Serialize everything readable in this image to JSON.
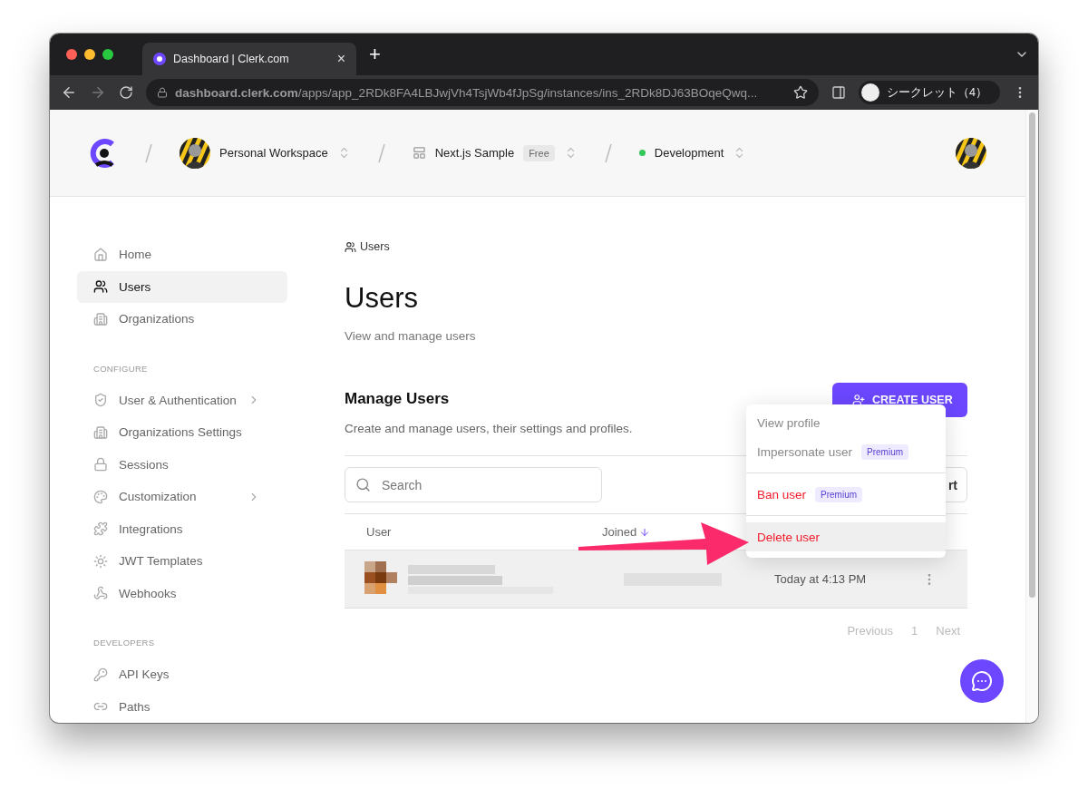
{
  "browser": {
    "tab": {
      "title": "Dashboard | Clerk.com",
      "close": "×"
    },
    "new_tab": "+",
    "url": "**dashboard.clerk.com**/apps/app_2RDk8FA4LBJwjVh4TsjWb4fJpSg/instances/ins_2RDk8DJ63BOqeQwq...",
    "profile": "シークレット（4）"
  },
  "header": {
    "workspace": "Personal Workspace",
    "application": {
      "name": "Next.js Sample",
      "badge": "Free"
    },
    "environment": {
      "name": "Development",
      "color": "#33c759"
    }
  },
  "sidebar": {
    "sections": [
      {
        "items": [
          {
            "label": "Home",
            "selected": false,
            "expandable": false
          },
          {
            "label": "Users",
            "selected": true,
            "expandable": false
          },
          {
            "label": "Organizations",
            "selected": false,
            "expandable": false
          }
        ]
      },
      {
        "title": "CONFIGURE",
        "items": [
          {
            "label": "User & Authentication",
            "selected": false,
            "expandable": true
          },
          {
            "label": "Organizations Settings",
            "selected": false,
            "expandable": false
          },
          {
            "label": "Sessions",
            "selected": false,
            "expandable": false
          },
          {
            "label": "Customization",
            "selected": false,
            "expandable": true
          },
          {
            "label": "Integrations",
            "selected": false,
            "expandable": false
          },
          {
            "label": "JWT Templates",
            "selected": false,
            "expandable": false
          },
          {
            "label": "Webhooks",
            "selected": false,
            "expandable": false
          }
        ]
      },
      {
        "title": "DEVELOPERS",
        "items": [
          {
            "label": "API Keys",
            "selected": false,
            "expandable": false
          },
          {
            "label": "Paths",
            "selected": false,
            "expandable": false
          }
        ]
      }
    ]
  },
  "page": {
    "breadcrumb": "Users",
    "title": "Users",
    "subtitle": "View and manage users"
  },
  "manage": {
    "title": "Manage Users",
    "description": "Create and manage users, their settings and profiles.",
    "create_button": "CREATE USER",
    "export_button": "rt"
  },
  "search": {
    "placeholder": "Search"
  },
  "table": {
    "columns": [
      {
        "label": "User",
        "sorted": false
      },
      {
        "label": "Joined",
        "sorted": true
      }
    ],
    "rows": [
      {
        "last_active": "Today at 4:13 PM",
        "hovered": true
      }
    ]
  },
  "menu": {
    "items": [
      {
        "label": "View profile",
        "kind": "normal",
        "highlighted": false,
        "divider_before": false
      },
      {
        "label": "Impersonate user",
        "kind": "normal",
        "badge": "Premium",
        "highlighted": false,
        "divider_before": false
      },
      {
        "label": "Ban user",
        "kind": "danger",
        "badge": "Premium",
        "highlighted": false,
        "divider_before": true
      },
      {
        "label": "Delete user",
        "kind": "danger",
        "highlighted": true,
        "divider_before": true
      }
    ]
  },
  "pagination": {
    "previous": "Previous",
    "page": "1",
    "next": "Next"
  }
}
